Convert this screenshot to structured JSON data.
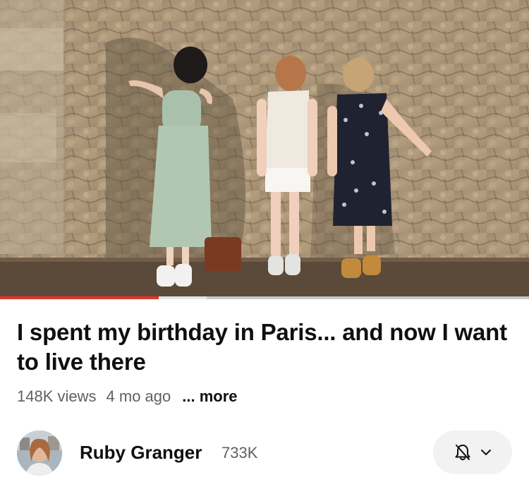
{
  "video": {
    "title": "I spent my birthday in Paris... and now I want to live there",
    "views": "148K views",
    "age": "4 mo ago",
    "more_label": "... more",
    "progress_fraction": 0.3,
    "buffered_fraction": 0.39
  },
  "channel": {
    "name": "Ruby Granger",
    "subscribers": "733K"
  },
  "subscribe": {
    "bell_icon": "bell-off-icon",
    "chevron_icon": "chevron-down-icon"
  },
  "colors": {
    "progress": "#e4332a",
    "text_secondary": "#606060",
    "pill_background": "#f2f2f2"
  }
}
